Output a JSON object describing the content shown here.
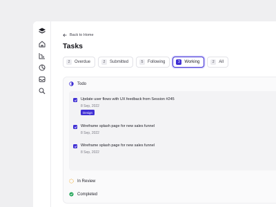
{
  "sidebar": {
    "icons": [
      "logo-icon",
      "home-icon",
      "chart-icon",
      "pie-chart-icon",
      "inbox-icon",
      "search-icon"
    ]
  },
  "header": {
    "back_label": "Back to Home",
    "title": "Tasks"
  },
  "tabs": [
    {
      "count": "2",
      "label": "Overdue",
      "active": false
    },
    {
      "count": "2",
      "label": "Submitted",
      "active": false
    },
    {
      "count": "5",
      "label": "Following",
      "active": false
    },
    {
      "count": "3",
      "label": "Working",
      "active": true
    },
    {
      "count": "2",
      "label": "All",
      "active": false
    }
  ],
  "sections": {
    "todo": {
      "label": "Todo"
    },
    "in_review": {
      "label": "In Review"
    },
    "completed": {
      "label": "Completed"
    }
  },
  "tasks": [
    {
      "title": "Update user flows with UX feedback from Session #245",
      "date": "8 Sep, 2022",
      "tag": "Design"
    },
    {
      "title": "Wireframe splash page for new sales funnel",
      "date": "8 Sep, 2022"
    },
    {
      "title": "Wireframe splash page for new sales funnel",
      "date": "8 Sep, 2022"
    }
  ],
  "colors": {
    "accent": "#3f2fd4",
    "in_review": "#f0b040",
    "completed": "#23a559",
    "background": "#efeff1"
  }
}
